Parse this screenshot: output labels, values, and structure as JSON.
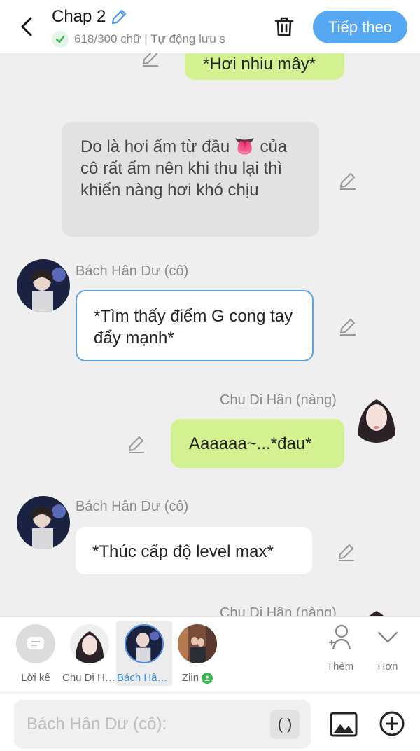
{
  "header": {
    "title": "Chap 2",
    "subtitle": "618/300 chữ | Tự động lưu s",
    "next_label": "Tiếp theo"
  },
  "messages": [
    {
      "text": "*Hơi nhiu mây*"
    },
    {
      "text": "Do là hơi ấm từ đầu 👅 của cô rất ấm nên khi thu lại thì khiến nàng hơi khó chịu"
    },
    {
      "speaker": "Bách Hân Dư (cô)",
      "text": "*Tìm thấy điểm G cong tay đẩy mạnh*"
    },
    {
      "speaker": "Chu Di Hân (nàng)",
      "text": "Aaaaaa~...*đau*"
    },
    {
      "speaker": "Bách Hân Dư (cô)",
      "text": "*Thúc cấp độ level max*"
    },
    {
      "speaker": "Chu Di Hân (nàng)"
    }
  ],
  "characters": [
    {
      "label": "Lời kể"
    },
    {
      "label": "Chu Di Hâ..."
    },
    {
      "label": "Bách Hân ..."
    },
    {
      "label": "Ziin"
    }
  ],
  "tools": {
    "add_label": "Thêm",
    "more_label": "Hơn"
  },
  "composer": {
    "placeholder": "Bách Hân Dư (cô):",
    "paren_label": "( )"
  },
  "colors": {
    "accent": "#57a8f2",
    "bubble_green": "#d4f191",
    "selected_border": "#5ba4e6"
  }
}
